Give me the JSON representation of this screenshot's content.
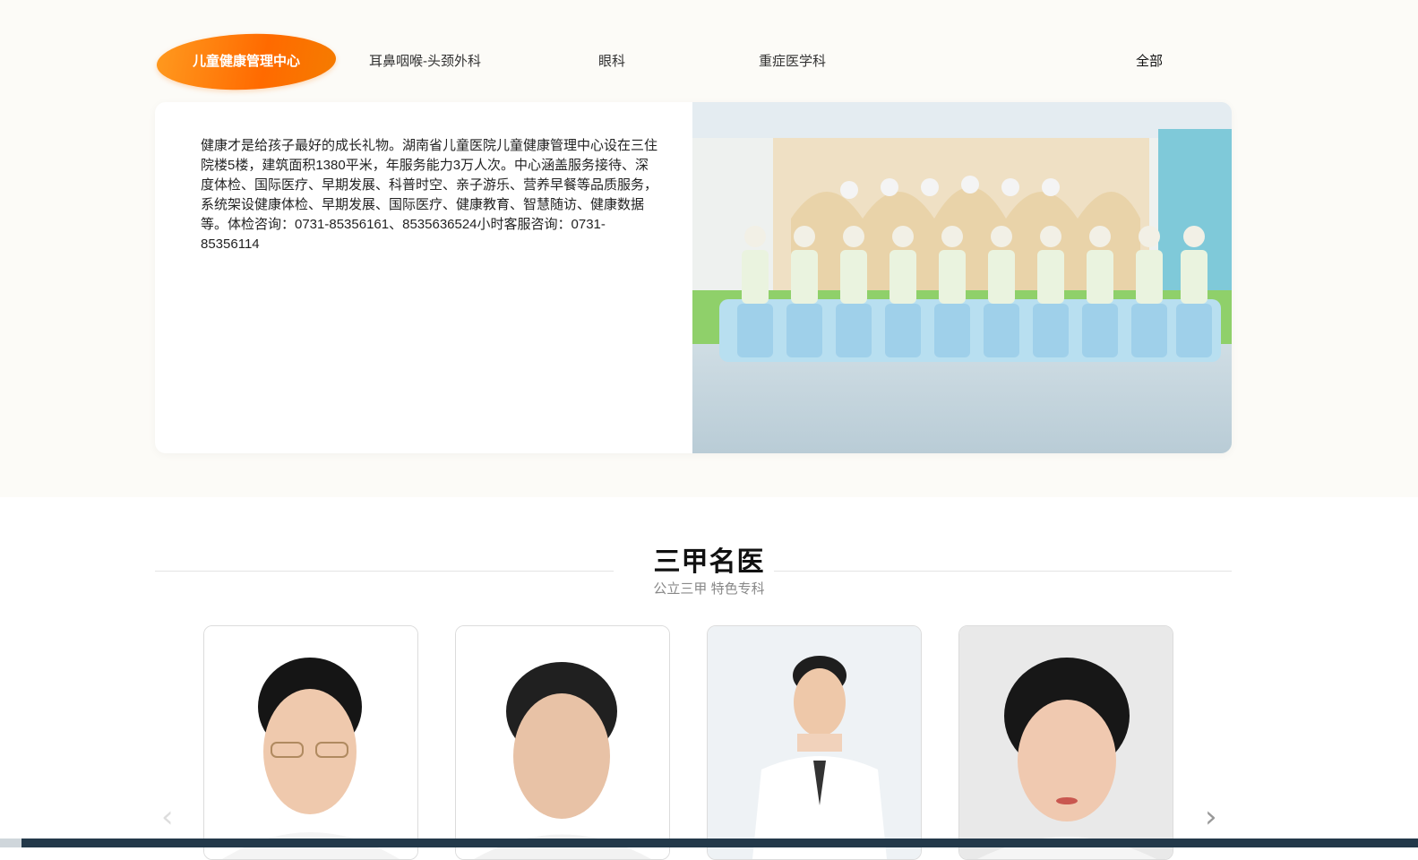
{
  "tabs": [
    {
      "label": "儿童健康管理中心",
      "active": true
    },
    {
      "label": "耳鼻咽喉-头颈外科",
      "active": false
    },
    {
      "label": "眼科",
      "active": false
    },
    {
      "label": "重症医学科",
      "active": false
    }
  ],
  "all_label": "全部",
  "info": {
    "text": "健康才是给孩子最好的成长礼物。湖南省儿童医院儿童健康管理中心设在三住院楼5楼，建筑面积1380平米，年服务能力3万人次。中心涵盖服务接待、深度体检、国际医疗、早期发展、科普时空、亲子游乐、营养早餐等品质服务，系统架设健康体检、早期发展、国际医疗、健康教育、智慧随访、健康数据等。体检咨询：0731-85356161、8535636524小时客服咨询：0731-85356114"
  },
  "section": {
    "title": "三甲名医",
    "subtitle": "公立三甲 特色专科"
  },
  "carousel": {
    "prev_icon": "chevron-left-icon",
    "next_icon": "chevron-right-icon",
    "prev_glyph": "‹",
    "next_glyph": "›"
  },
  "colors": {
    "accent": "#ff7a00",
    "band_bg": "#fcfbf7",
    "footer_bar": "#23394a"
  }
}
